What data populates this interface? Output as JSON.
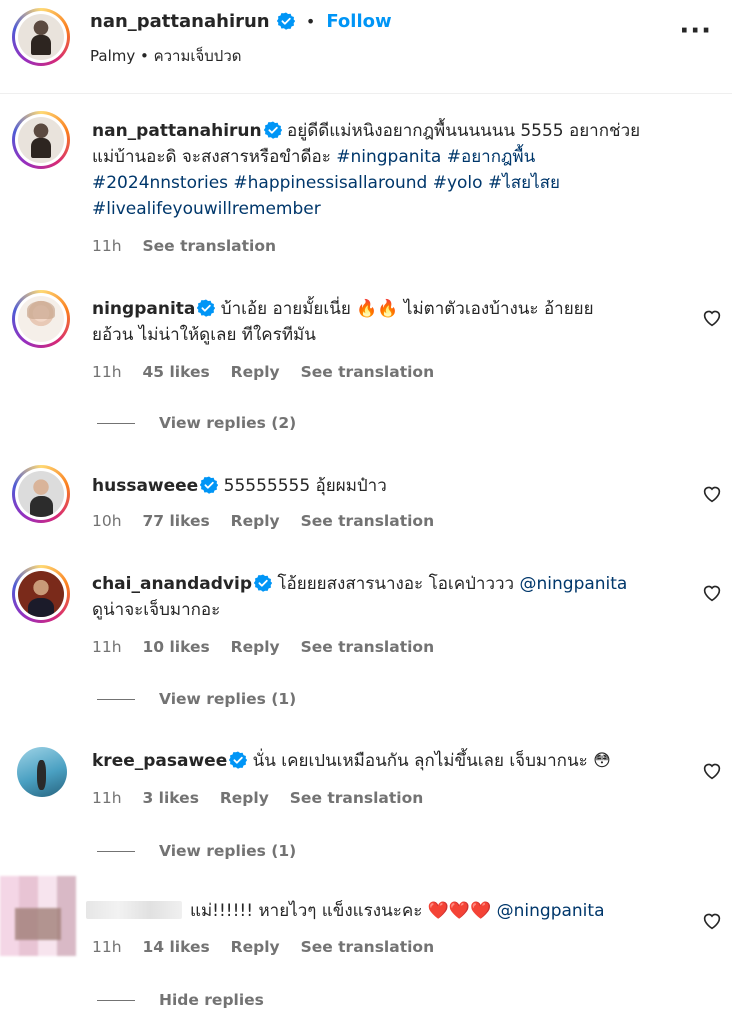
{
  "header": {
    "username": "nan_pattanahirun",
    "separator": "•",
    "follow_label": "Follow",
    "subtitle": "Palmy • ความเจ็บปวด",
    "more_icon": "more-horizontal-icon"
  },
  "caption": {
    "username": "nan_pattanahirun",
    "text_line1": "อยู่ดีดีแม่หนิงอยากฎพื้นนนนนน 5555 อยากช่วย",
    "text_line2a": "แม่บ้านอะดิ จะสงสารหรือขำดีอะ ",
    "tag1": "#ningpanita",
    "tag2": "#อยากฎพื้น",
    "tag3": "#2024nnstories #happinessisallaround #yolo #ไสยไสย",
    "tag4": "#livealifeyouwillremember",
    "time": "11h",
    "see_translation": "See translation"
  },
  "comments": [
    {
      "username": "ningpanita",
      "line1": "บ้าเอ้ย อายมั้ยเนี่ย 🔥🔥 ไม่ตาตัวเองบ้างนะ อ้ายยย",
      "line2": "ยอ้วน ไม่น่าให้ดูเลย ทีใครทีมัน",
      "time": "11h",
      "likes": "45 likes",
      "reply": "Reply",
      "see_translation": "See translation",
      "view_replies": "View replies (2)"
    },
    {
      "username": "hussaweee",
      "line1": "55555555 อุ้ยผมป๋าว",
      "time": "10h",
      "likes": "77 likes",
      "reply": "Reply",
      "see_translation": "See translation"
    },
    {
      "username": "chai_anandadvip",
      "line1": "โอ้ยยยสงสารนางอะ โอเคป่าววว ",
      "mention": "@ningpanita",
      "line2": "ดูน่าจะเจ็บมากอะ",
      "time": "11h",
      "likes": "10 likes",
      "reply": "Reply",
      "see_translation": "See translation",
      "view_replies": "View replies (1)"
    },
    {
      "username": "kree_pasawee",
      "line1": "นั่น เคยเปนเหมือนกัน ลุกไม่ขึ้นเลย เจ็บมากนะ 😳",
      "time": "11h",
      "likes": "3 likes",
      "reply": "Reply",
      "see_translation": "See translation",
      "view_replies": "View replies (1)"
    },
    {
      "line1": "แม่!!!!!! หายไวๆ แข็งแรงนะคะ ❤️❤️❤️ ",
      "mention": "@ningpanita",
      "time": "11h",
      "likes": "14 likes",
      "reply": "Reply",
      "see_translation": "See translation",
      "hide_replies": "Hide replies"
    }
  ],
  "colors": {
    "link": "#0095f6",
    "hashtag": "#00376b",
    "muted": "#737373",
    "verified": "#0095f6"
  }
}
